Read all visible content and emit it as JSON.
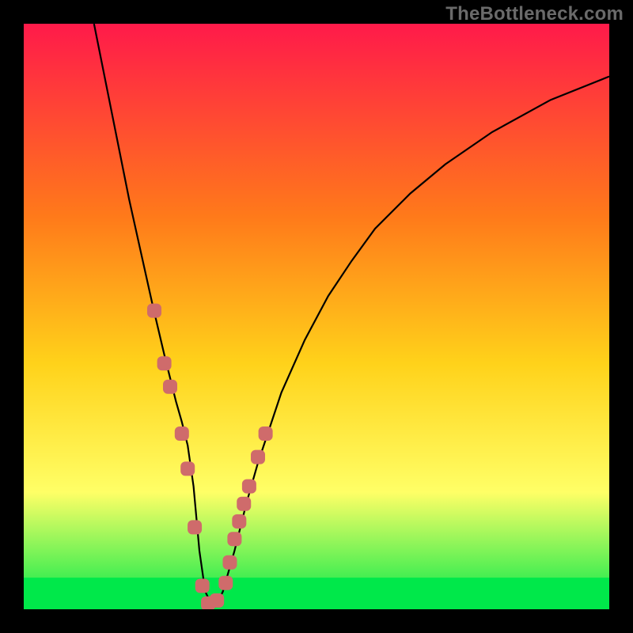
{
  "watermark": "TheBottleneck.com",
  "colors": {
    "frame": "#000000",
    "gradient_top": "#ff1a4a",
    "gradient_mid1": "#ff7a1a",
    "gradient_mid2": "#ffd21a",
    "gradient_mid3": "#ffff66",
    "gradient_bottom": "#00e84a",
    "curve": "#000000",
    "marker_fill": "#cf6b6b",
    "marker_stroke": "#cf6b6b"
  },
  "chart_data": {
    "type": "line",
    "title": "",
    "xlabel": "",
    "ylabel": "",
    "xlim": [
      0,
      100
    ],
    "ylim": [
      0,
      100
    ],
    "series": [
      {
        "name": "bottleneck-curve",
        "x": [
          12,
          14,
          16,
          18,
          20,
          22,
          24,
          26,
          27,
          28,
          29,
          30,
          31,
          32,
          33,
          34,
          36,
          38,
          40,
          44,
          48,
          52,
          56,
          60,
          66,
          72,
          80,
          90,
          100
        ],
        "values": [
          100,
          90,
          80,
          70,
          61,
          52,
          43.5,
          35.5,
          32,
          28,
          21,
          10,
          3,
          1,
          1,
          3,
          10,
          18,
          25,
          37,
          46,
          53.5,
          59.5,
          65,
          71,
          76,
          81.5,
          87,
          91
        ]
      }
    ],
    "markers": {
      "name": "highlighted-points",
      "x": [
        22.3,
        24.0,
        25.0,
        27.0,
        28.0,
        29.2,
        30.5,
        31.5,
        33.0,
        34.5,
        35.2,
        36.0,
        36.8,
        37.6,
        38.5,
        40.0,
        41.3
      ],
      "values": [
        51.0,
        42.0,
        38.0,
        30.0,
        24.0,
        14.0,
        4.0,
        1.0,
        1.5,
        4.5,
        8.0,
        12.0,
        15.0,
        18.0,
        21.0,
        26.0,
        30.0
      ]
    }
  }
}
